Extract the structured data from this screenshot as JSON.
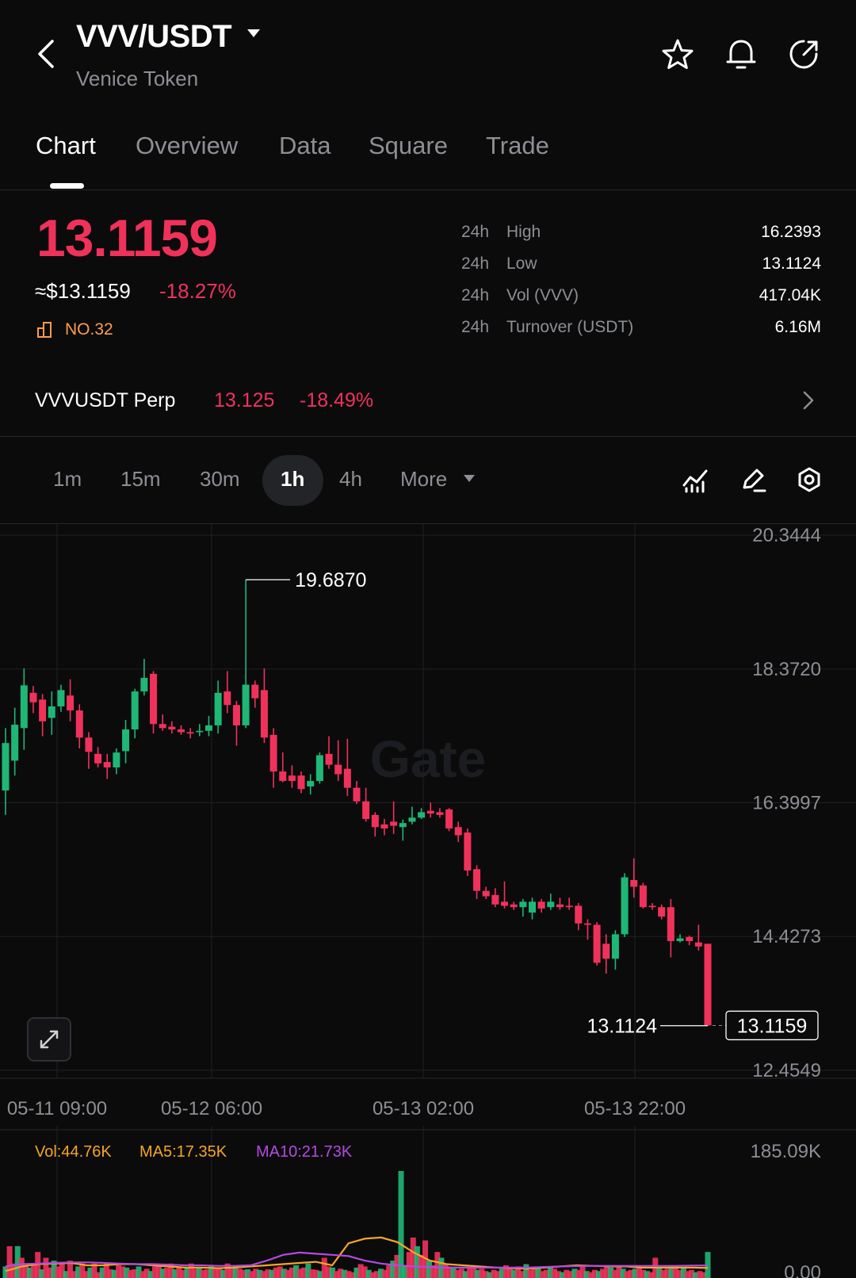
{
  "header": {
    "pair": "VVV/USDT",
    "token_name": "Venice Token",
    "icons": [
      "back-arrow-icon",
      "caret-down-icon",
      "star-icon",
      "bell-icon",
      "share-icon"
    ]
  },
  "tabs": [
    "Chart",
    "Overview",
    "Data",
    "Square",
    "Trade"
  ],
  "active_tab": "Chart",
  "price": {
    "last": "13.1159",
    "usd": "≈$13.1159",
    "change": "-18.27%",
    "rank": "NO.32"
  },
  "stats": [
    {
      "period": "24h",
      "label": "High",
      "value": "16.2393"
    },
    {
      "period": "24h",
      "label": "Low",
      "value": "13.1124"
    },
    {
      "period": "24h",
      "label": "Vol (VVV)",
      "value": "417.04K"
    },
    {
      "period": "24h",
      "label": "Turnover (USDT)",
      "value": "6.16M"
    }
  ],
  "perp": {
    "name": "VVVUSDT Perp",
    "price": "13.125",
    "change": "-18.49%"
  },
  "intervals": {
    "items": [
      "1m",
      "15m",
      "30m",
      "1h",
      "4h"
    ],
    "more_label": "More",
    "active": "1h",
    "tool_icons": [
      "indicators-icon",
      "draw-icon",
      "settings-icon"
    ]
  },
  "colors": {
    "up": "#1fb776",
    "down": "#f0325b",
    "ma5": "#f5a623",
    "ma10": "#b44ae0",
    "accent_rank": "#ff9d4a",
    "background": "#0b0b0c"
  },
  "chart_data": {
    "type": "candlestick",
    "interval": "1h",
    "watermark": "Gate",
    "y_axis": [
      "20.3444",
      "18.3720",
      "16.3997",
      "14.4273",
      "12.4549"
    ],
    "ylim": [
      12.4549,
      20.3444
    ],
    "x_axis": [
      "05-11 09:00",
      "05-12 06:00",
      "05-13 02:00",
      "05-13 22:00"
    ],
    "high_label": "19.6870",
    "low_label": "13.1124",
    "current_label": "13.1159",
    "candles": [
      {
        "o": 16.58,
        "c": 17.28,
        "h": 17.5,
        "l": 16.22
      },
      {
        "o": 17.02,
        "c": 17.55,
        "h": 17.8,
        "l": 16.8
      },
      {
        "o": 17.5,
        "c": 18.13,
        "h": 18.38,
        "l": 17.18
      },
      {
        "o": 18.02,
        "c": 17.88,
        "h": 18.12,
        "l": 17.72
      },
      {
        "o": 17.92,
        "c": 17.6,
        "h": 18.0,
        "l": 17.38
      },
      {
        "o": 17.65,
        "c": 17.82,
        "h": 18.04,
        "l": 17.4
      },
      {
        "o": 17.82,
        "c": 18.06,
        "h": 18.14,
        "l": 17.74
      },
      {
        "o": 17.98,
        "c": 17.76,
        "h": 18.22,
        "l": 17.6
      },
      {
        "o": 17.76,
        "c": 17.36,
        "h": 17.85,
        "l": 17.2
      },
      {
        "o": 17.36,
        "c": 17.15,
        "h": 17.44,
        "l": 16.9
      },
      {
        "o": 17.12,
        "c": 16.98,
        "h": 17.22,
        "l": 16.92
      },
      {
        "o": 17.0,
        "c": 16.92,
        "h": 17.12,
        "l": 16.75
      },
      {
        "o": 16.92,
        "c": 17.14,
        "h": 17.2,
        "l": 16.82
      },
      {
        "o": 17.16,
        "c": 17.48,
        "h": 17.62,
        "l": 16.98
      },
      {
        "o": 17.48,
        "c": 18.04,
        "h": 18.08,
        "l": 17.35
      },
      {
        "o": 18.04,
        "c": 18.24,
        "h": 18.52,
        "l": 17.98
      },
      {
        "o": 18.3,
        "c": 17.56,
        "h": 18.34,
        "l": 17.42
      },
      {
        "o": 17.56,
        "c": 17.5,
        "h": 17.7,
        "l": 17.46
      },
      {
        "o": 17.52,
        "c": 17.48,
        "h": 17.6,
        "l": 17.42
      },
      {
        "o": 17.48,
        "c": 17.44,
        "h": 17.54,
        "l": 17.4
      },
      {
        "o": 17.44,
        "c": 17.42,
        "h": 17.5,
        "l": 17.35
      },
      {
        "o": 17.44,
        "c": 17.46,
        "h": 17.56,
        "l": 17.38
      },
      {
        "o": 17.46,
        "c": 17.54,
        "h": 17.68,
        "l": 17.38
      },
      {
        "o": 17.54,
        "c": 18.02,
        "h": 18.2,
        "l": 17.42
      },
      {
        "o": 18.04,
        "c": 17.84,
        "h": 18.34,
        "l": 17.72
      },
      {
        "o": 17.84,
        "c": 17.54,
        "h": 17.9,
        "l": 17.24
      },
      {
        "o": 17.54,
        "c": 18.14,
        "h": 19.687,
        "l": 17.5
      },
      {
        "o": 18.14,
        "c": 17.94,
        "h": 18.2,
        "l": 17.8
      },
      {
        "o": 18.06,
        "c": 17.36,
        "h": 18.38,
        "l": 17.28
      },
      {
        "o": 17.4,
        "c": 16.86,
        "h": 17.5,
        "l": 16.62
      },
      {
        "o": 16.86,
        "c": 16.72,
        "h": 17.14,
        "l": 16.7
      },
      {
        "o": 16.8,
        "c": 16.72,
        "h": 16.95,
        "l": 16.62
      },
      {
        "o": 16.8,
        "c": 16.6,
        "h": 16.86,
        "l": 16.54
      },
      {
        "o": 16.64,
        "c": 16.72,
        "h": 16.82,
        "l": 16.52
      },
      {
        "o": 16.72,
        "c": 17.1,
        "h": 17.14,
        "l": 16.68
      },
      {
        "o": 17.12,
        "c": 16.96,
        "h": 17.38,
        "l": 16.9
      },
      {
        "o": 16.96,
        "c": 16.82,
        "h": 17.32,
        "l": 16.72
      },
      {
        "o": 16.9,
        "c": 16.62,
        "h": 17.34,
        "l": 16.5
      },
      {
        "o": 16.62,
        "c": 16.42,
        "h": 16.72,
        "l": 16.38
      },
      {
        "o": 16.42,
        "c": 16.16,
        "h": 16.62,
        "l": 16.12
      },
      {
        "o": 16.22,
        "c": 16.04,
        "h": 16.26,
        "l": 15.9
      },
      {
        "o": 16.08,
        "c": 16.02,
        "h": 16.16,
        "l": 15.92
      },
      {
        "o": 16.12,
        "c": 16.06,
        "h": 16.42,
        "l": 15.94
      },
      {
        "o": 16.04,
        "c": 16.1,
        "h": 16.15,
        "l": 15.84
      },
      {
        "o": 16.12,
        "c": 16.18,
        "h": 16.34,
        "l": 16.08
      },
      {
        "o": 16.18,
        "c": 16.26,
        "h": 16.32,
        "l": 16.16
      },
      {
        "o": 16.28,
        "c": 16.24,
        "h": 16.4,
        "l": 16.18
      },
      {
        "o": 16.26,
        "c": 16.22,
        "h": 16.32,
        "l": 16.18
      },
      {
        "o": 16.3,
        "c": 16.02,
        "h": 16.32,
        "l": 15.98
      },
      {
        "o": 16.04,
        "c": 15.92,
        "h": 16.12,
        "l": 15.82
      },
      {
        "o": 15.96,
        "c": 15.4,
        "h": 16.02,
        "l": 15.32
      },
      {
        "o": 15.42,
        "c": 15.1,
        "h": 15.48,
        "l": 14.98
      },
      {
        "o": 15.1,
        "c": 15.02,
        "h": 15.16,
        "l": 14.98
      },
      {
        "o": 15.04,
        "c": 14.9,
        "h": 15.14,
        "l": 14.86
      },
      {
        "o": 14.94,
        "c": 14.88,
        "h": 15.24,
        "l": 14.84
      },
      {
        "o": 14.9,
        "c": 14.86,
        "h": 14.94,
        "l": 14.82
      },
      {
        "o": 14.86,
        "c": 14.94,
        "h": 14.98,
        "l": 14.72
      },
      {
        "o": 14.78,
        "c": 14.94,
        "h": 15.0,
        "l": 14.68
      },
      {
        "o": 14.94,
        "c": 14.84,
        "h": 14.98,
        "l": 14.78
      },
      {
        "o": 14.86,
        "c": 14.94,
        "h": 15.06,
        "l": 14.82
      },
      {
        "o": 14.9,
        "c": 14.86,
        "h": 15.0,
        "l": 14.82
      },
      {
        "o": 14.88,
        "c": 14.86,
        "h": 15.0,
        "l": 14.82
      },
      {
        "o": 14.88,
        "c": 14.62,
        "h": 14.92,
        "l": 14.52
      },
      {
        "o": 14.62,
        "c": 14.6,
        "h": 14.68,
        "l": 14.38
      },
      {
        "o": 14.6,
        "c": 14.04,
        "h": 14.64,
        "l": 14.0
      },
      {
        "o": 14.32,
        "c": 14.1,
        "h": 14.46,
        "l": 13.88
      },
      {
        "o": 14.1,
        "c": 14.46,
        "h": 14.52,
        "l": 13.94
      },
      {
        "o": 14.46,
        "c": 15.3,
        "h": 15.36,
        "l": 14.42
      },
      {
        "o": 15.26,
        "c": 15.16,
        "h": 15.58,
        "l": 15.0
      },
      {
        "o": 15.18,
        "c": 14.86,
        "h": 15.22,
        "l": 14.84
      },
      {
        "o": 14.88,
        "c": 14.86,
        "h": 14.92,
        "l": 14.82
      },
      {
        "o": 14.86,
        "c": 14.72,
        "h": 14.9,
        "l": 14.68
      },
      {
        "o": 14.86,
        "c": 14.36,
        "h": 14.98,
        "l": 14.12
      },
      {
        "o": 14.36,
        "c": 14.4,
        "h": 14.46,
        "l": 14.34
      },
      {
        "o": 14.42,
        "c": 14.36,
        "h": 14.44,
        "l": 14.3
      },
      {
        "o": 14.34,
        "c": 14.28,
        "h": 14.6,
        "l": 14.22
      },
      {
        "o": 14.32,
        "c": 13.1159,
        "h": 14.32,
        "l": 13.1124
      }
    ],
    "volume": {
      "ylim": [
        0,
        185090
      ],
      "y_axis": [
        "185.09K",
        "0.00"
      ],
      "legend": {
        "vol": "Vol:44.76K",
        "ma5": "MA5:17.35K",
        "ma10": "MA10:21.73K"
      },
      "values": [
        20000,
        55000,
        25000,
        55000,
        35000,
        20000,
        18000,
        25000,
        45000,
        15000,
        35000,
        18000,
        30000,
        20000,
        25000,
        12000,
        30000,
        12000,
        20000,
        25000,
        12000,
        18000,
        25000,
        10000,
        18000,
        25000,
        15000,
        14000,
        22000,
        20000,
        18000,
        14000,
        15000,
        20000,
        12000,
        16000,
        12000,
        20000,
        22000,
        16000,
        18000,
        25000,
        15000,
        18000,
        14000,
        18000,
        25000,
        16000,
        18000,
        14000,
        15000,
        20000,
        16000,
        18000,
        14000,
        25000,
        18000,
        20000,
        16000,
        14000,
        15000,
        12000,
        16000,
        14000,
        12000,
        15000,
        14000,
        18000,
        20000,
        16000,
        14000,
        18000,
        22000,
        16000,
        18000,
        25000,
        15000,
        14000,
        12000,
        35000,
        20000,
        18000,
        12000,
        16000,
        14000,
        12000,
        10000,
        18000,
        24000,
        20000,
        14000,
        10000,
        12000,
        16000,
        14000,
        22000,
        30000,
        40000,
        185090,
        22000,
        45000,
        70000,
        55000,
        40000,
        65000,
        30000,
        22000,
        45000,
        35000,
        25000,
        20000,
        18000,
        14000,
        16000,
        12000,
        18000,
        22000,
        14000,
        16000,
        12000,
        10000,
        14000,
        12000,
        16000,
        22000,
        18000,
        14000,
        20000,
        12000,
        24000,
        14000,
        18000,
        16000,
        12000,
        14000,
        18000,
        16000,
        12000,
        10000,
        14000,
        12000,
        16000,
        14000,
        20000,
        12000,
        10000,
        14000,
        12000,
        16000,
        22000,
        18000,
        14000,
        20000,
        16000,
        12000,
        14000,
        16000,
        18000,
        14000,
        12000,
        10000,
        35000,
        18000,
        14000,
        16000,
        22000,
        20000,
        14000,
        18000,
        12000,
        14000,
        10000,
        12000,
        10000,
        45000
      ]
    },
    "ma5_line": [
      12000,
      20000,
      24000,
      25000,
      26000,
      22000,
      22000,
      24000,
      24000,
      22000,
      20000,
      18000,
      18000,
      17000,
      18000,
      20000,
      22000,
      24000,
      26000,
      28000,
      22000,
      60000,
      68000,
      70000,
      62000,
      44000,
      30000,
      24000,
      22000,
      20000,
      18000,
      17000,
      16000,
      18000,
      20000,
      22000,
      21000,
      20000,
      20000,
      18000,
      18000,
      18000,
      18000,
      17350
    ],
    "ma10_line": [
      20000,
      24000,
      25000,
      26000,
      27000,
      27000,
      26000,
      25000,
      24000,
      24000,
      23000,
      22000,
      22000,
      21000,
      21000,
      22000,
      30000,
      40000,
      44000,
      42000,
      40000,
      38000,
      30000,
      25000,
      22000,
      20000,
      19000,
      18000,
      18000,
      18000,
      18000,
      18000,
      18000,
      19000,
      20000,
      20500,
      21000,
      21000,
      21000,
      21000,
      21000,
      21000,
      21500,
      21730
    ]
  }
}
